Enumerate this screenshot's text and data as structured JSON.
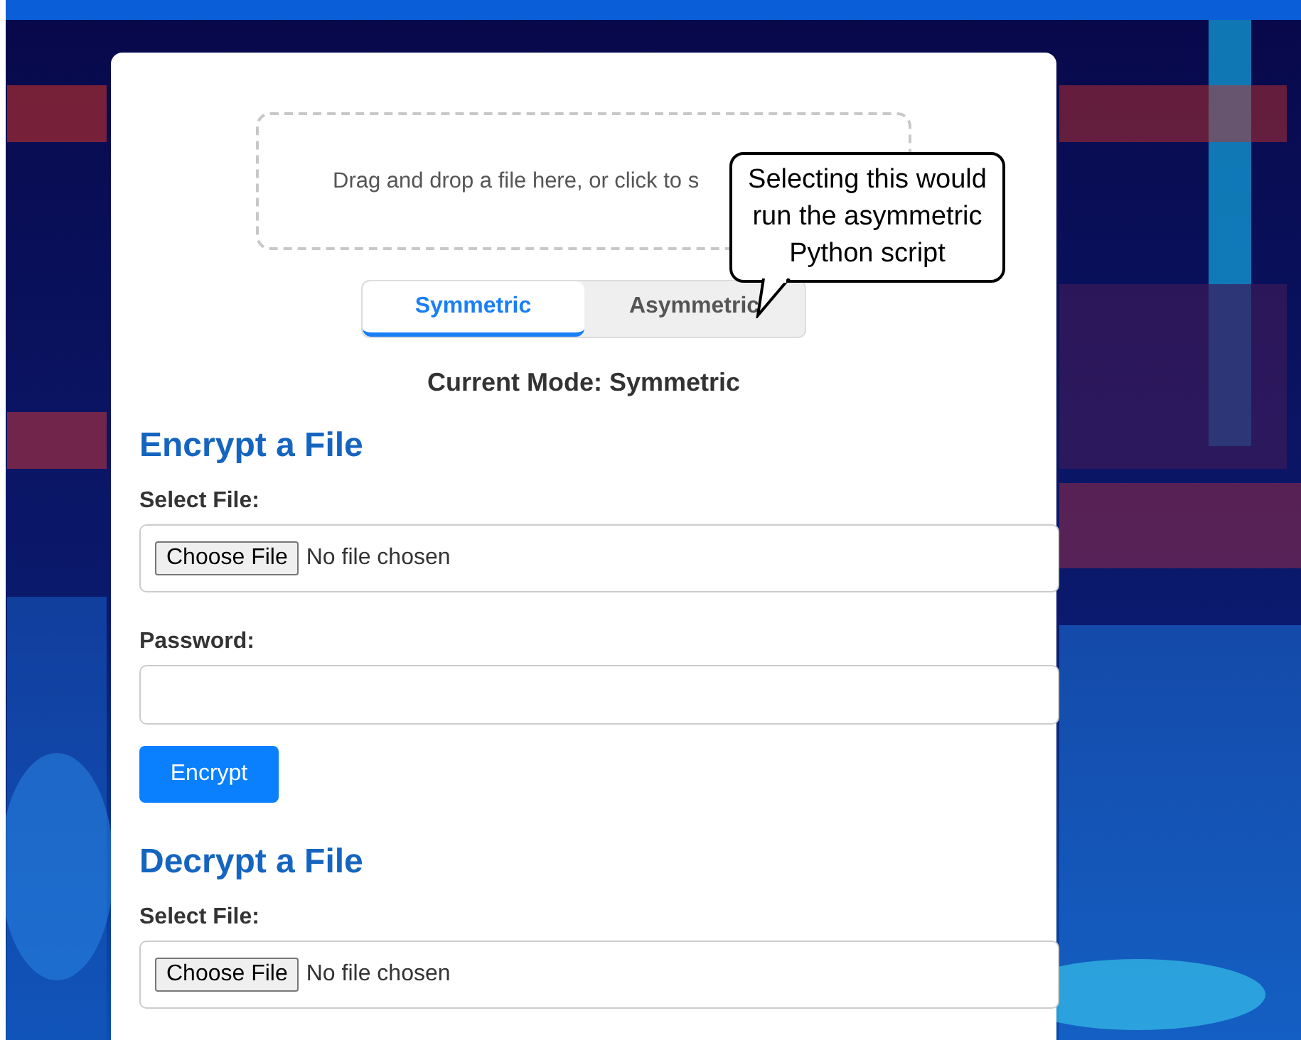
{
  "dropzone": {
    "text": "Drag and drop a file here, or click to s"
  },
  "tooltip": {
    "text": "Selecting this would run the asymmetric Python script"
  },
  "mode_tabs": [
    {
      "label": "Symmetric",
      "selected": true
    },
    {
      "label": "Asymmetric",
      "selected": false
    }
  ],
  "current_mode": "Current Mode: Symmetric",
  "sections": [
    {
      "title": "Encrypt a File",
      "fields": [
        {
          "kind": "file",
          "label": "Select File:",
          "button": "Choose File",
          "status": "No file chosen"
        },
        {
          "kind": "password",
          "label": "Password:"
        }
      ],
      "button": "Encrypt"
    },
    {
      "title": "Decrypt a File",
      "fields": [
        {
          "kind": "file",
          "label": "Select File:",
          "button": "Choose File",
          "status": "No file chosen"
        }
      ]
    }
  ]
}
